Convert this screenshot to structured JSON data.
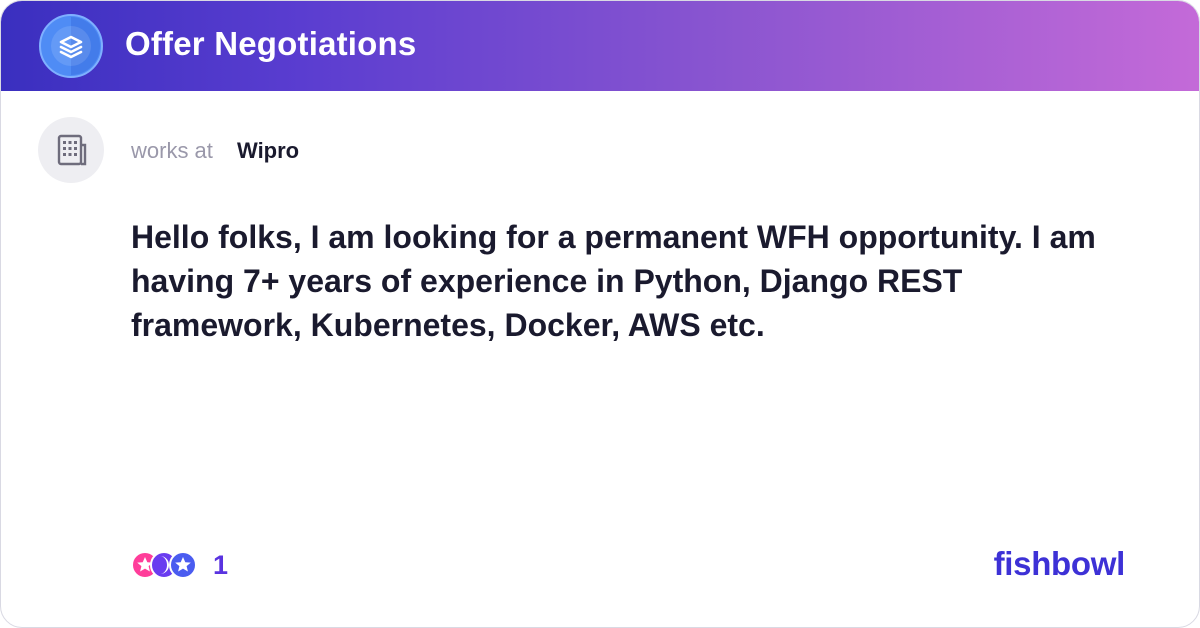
{
  "header": {
    "title": "Offer Negotiations",
    "logo_icon": "bowl-layers-icon",
    "gradient": [
      "#3a2fbf",
      "#c46ad8"
    ]
  },
  "author": {
    "works_at_label": "works at",
    "company": "Wipro",
    "avatar_icon": "building-icon"
  },
  "post": {
    "body": "Hello folks, I am looking for a permanent WFH opportunity. I am having 7+ years of experience in Python, Django REST framework, Kubernetes, Docker, AWS etc."
  },
  "reactions": {
    "count": "1",
    "icons": [
      "star-reaction-icon",
      "moon-reaction-icon",
      "star-reaction-icon"
    ]
  },
  "brand": {
    "name": "fishbowl",
    "color": "#3d31d6"
  }
}
